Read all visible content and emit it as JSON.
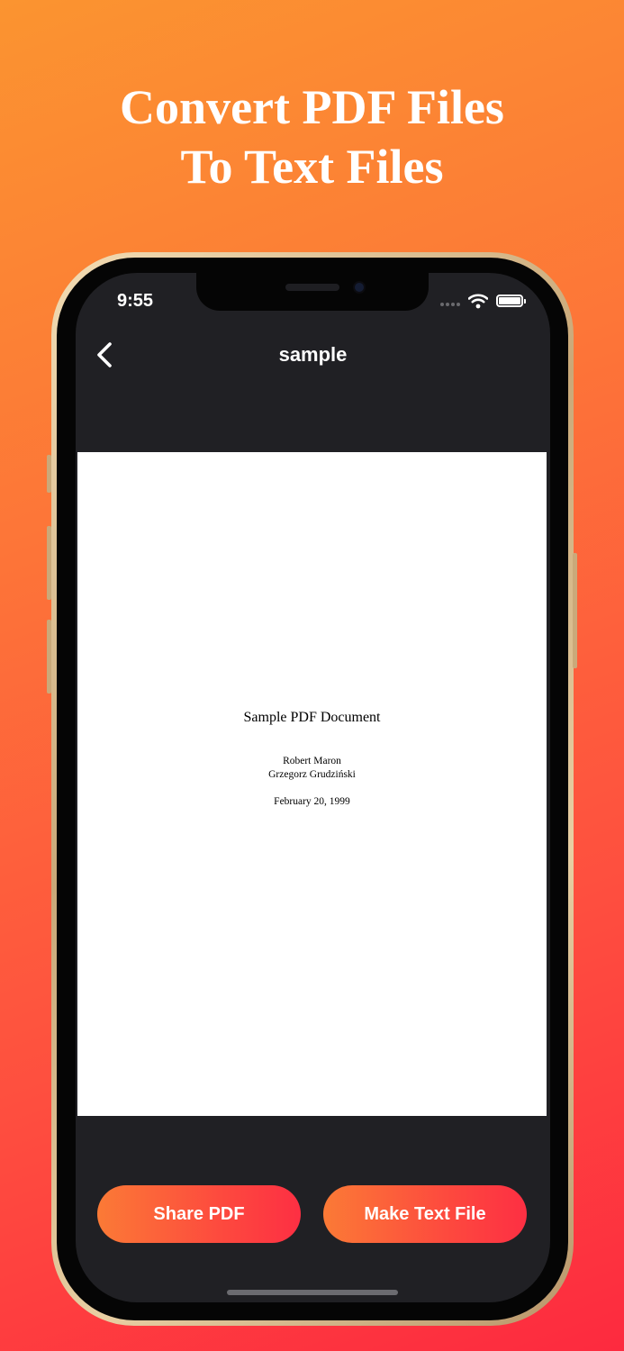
{
  "headline": {
    "line1": "Convert PDF Files",
    "line2": "To Text Files"
  },
  "status_bar": {
    "time": "9:55",
    "icons": [
      "signal-dots-icon",
      "wifi-icon",
      "battery-icon"
    ]
  },
  "nav": {
    "back_icon": "chevron-left-icon",
    "title": "sample"
  },
  "pdf": {
    "title": "Sample PDF Document",
    "authors": [
      "Robert Maron",
      "Grzegorz Grudziński"
    ],
    "date": "February 20, 1999"
  },
  "actions": {
    "share_label": "Share PDF",
    "make_label": "Make Text File"
  },
  "colors": {
    "background_start": "#fb9430",
    "background_end": "#fd2a3f",
    "screen_bg": "#202024",
    "button_start": "#fb7a36",
    "button_end": "#fd2f43"
  }
}
